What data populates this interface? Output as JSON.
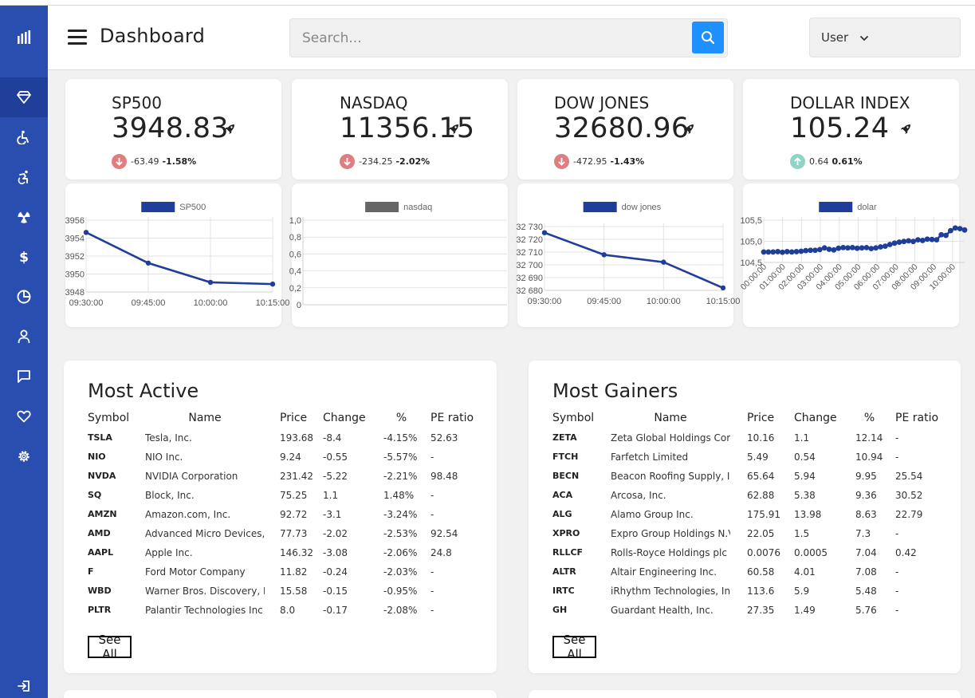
{
  "header": {
    "title": "Dashboard",
    "search_placeholder": "Search...",
    "user_label": "User"
  },
  "sidebar": {
    "items": [
      {
        "icon": "bar-chart-icon"
      },
      {
        "icon": "diamond-icon"
      },
      {
        "icon": "wheelchair-icon"
      },
      {
        "icon": "accessible-running-icon"
      },
      {
        "icon": "radiation-icon"
      },
      {
        "icon": "dollar-icon"
      },
      {
        "icon": "pie-chart-icon"
      },
      {
        "icon": "user-icon"
      },
      {
        "icon": "message-icon"
      },
      {
        "icon": "heart-icon"
      },
      {
        "icon": "gear-icon"
      },
      {
        "icon": "logout-icon"
      }
    ]
  },
  "indices": [
    {
      "name": "SP500",
      "value": "3948.83",
      "change": "-63.49",
      "percent": "-1.58%",
      "direction": "down"
    },
    {
      "name": "NASDAQ",
      "value": "11356.15",
      "change": "-234.25",
      "percent": "-2.02%",
      "direction": "down"
    },
    {
      "name": "DOW JONES",
      "value": "32680.96",
      "change": "-472.95",
      "percent": "-1.43%",
      "direction": "down"
    },
    {
      "name": "DOLLAR INDEX",
      "value": "105.24",
      "change": "0.64",
      "percent": "0.61%",
      "direction": "up"
    }
  ],
  "colors": {
    "sidebar": "#2a4db0",
    "series": "#1f3e99",
    "nasdaq_legend": "#666666",
    "down": "#e07d80",
    "up": "#8fd5c5",
    "search_button": "#1e90ff"
  },
  "chart_data": [
    {
      "type": "line",
      "legend": "SP500",
      "x": [
        "09:30:00",
        "09:45:00",
        "10:00:00",
        "10:15:00"
      ],
      "y": [
        3954.7,
        3951.2,
        3949.0,
        3948.8
      ],
      "yticks": [
        "3956",
        "3954",
        "3952",
        "3950",
        "3948"
      ],
      "ylim": [
        3947.9,
        3956.1
      ],
      "grid": true
    },
    {
      "type": "line",
      "legend": "nasdaq",
      "x": [],
      "y": [],
      "yticks": [
        "1,0",
        "0,8",
        "0,6",
        "0,4",
        "0,2",
        "0"
      ],
      "ylim": [
        0,
        1
      ],
      "grid": true
    },
    {
      "type": "line",
      "legend": "dow jones",
      "x": [
        "09:30:00",
        "09:45:00",
        "10:00:00",
        "10:15:00"
      ],
      "y": [
        32726,
        32708,
        32702,
        32681
      ],
      "yticks": [
        "32 730",
        "32 720",
        "32 710",
        "32 700",
        "32 690",
        "32 680"
      ],
      "ylim": [
        32679,
        32731
      ],
      "grid": true
    },
    {
      "type": "line",
      "legend": "dolar",
      "x": [
        "00:00:00",
        "",
        "",
        "",
        "01:00:00",
        "",
        "",
        "",
        "02:00:00",
        "",
        "",
        "",
        "03:00:00",
        "",
        "",
        "",
        "04:00:00",
        "",
        "",
        "",
        "05:00:00",
        "",
        "",
        "",
        "06:00:00",
        "",
        "",
        "",
        "07:00:00",
        "",
        "",
        "",
        "08:00:00",
        "",
        "",
        "",
        "09:00:00",
        "",
        "",
        "",
        "10:00:00",
        "",
        "",
        ""
      ],
      "xticks": [
        "00:00:00",
        "01:00:00",
        "02:00:00",
        "03:00:00",
        "04:00:00",
        "05:00:00",
        "06:00:00",
        "07:00:00",
        "08:00:00",
        "09:00:00",
        "10:00:00"
      ],
      "y": [
        104.56,
        104.56,
        104.56,
        104.57,
        104.55,
        104.57,
        104.56,
        104.57,
        104.58,
        104.6,
        104.61,
        104.61,
        104.63,
        104.68,
        104.64,
        104.62,
        104.67,
        104.69,
        104.68,
        104.69,
        104.67,
        104.68,
        104.69,
        104.66,
        104.68,
        104.71,
        104.73,
        104.78,
        104.82,
        104.85,
        104.87,
        104.89,
        104.87,
        104.92,
        104.9,
        104.94,
        104.93,
        104.92,
        105.07,
        105.05,
        105.19,
        105.27,
        105.25,
        105.21
      ],
      "yticks": [
        "105,5",
        "105,0",
        "104,5"
      ],
      "ylim": [
        104.25,
        105.5
      ],
      "grid": true
    }
  ],
  "most_active": {
    "title": "Most Active",
    "columns": [
      "Symbol",
      "Name",
      "Price",
      "Change",
      "%",
      "PE ratio"
    ],
    "rows": [
      [
        "TSLA",
        "Tesla, Inc.",
        "193.68",
        "-8.4",
        "-4.15%",
        "52.63"
      ],
      [
        "NIO",
        "NIO Inc.",
        "9.24",
        "-0.55",
        "-5.57%",
        "-"
      ],
      [
        "NVDA",
        "NVIDIA Corporation",
        "231.42",
        "-5.22",
        "-2.21%",
        "98.48"
      ],
      [
        "SQ",
        "Block, Inc.",
        "75.25",
        "1.1",
        "1.48%",
        "-"
      ],
      [
        "AMZN",
        "Amazon.com, Inc.",
        "92.72",
        "-3.1",
        "-3.24%",
        "-"
      ],
      [
        "AMD",
        "Advanced Micro Devices,",
        "77.73",
        "-2.02",
        "-2.53%",
        "92.54"
      ],
      [
        "AAPL",
        "Apple Inc.",
        "146.32",
        "-3.08",
        "-2.06%",
        "24.8"
      ],
      [
        "F",
        "Ford Motor Company",
        "11.82",
        "-0.24",
        "-2.03%",
        "-"
      ],
      [
        "WBD",
        "Warner Bros. Discovery, Ir",
        "15.58",
        "-0.15",
        "-0.95%",
        "-"
      ],
      [
        "PLTR",
        "Palantir Technologies Inc",
        "8.0",
        "-0.17",
        "-2.08%",
        "-"
      ]
    ],
    "see_all": "See All"
  },
  "most_gainers": {
    "title": "Most Gainers",
    "columns": [
      "Symbol",
      "Name",
      "Price",
      "Change",
      "%",
      "PE ratio"
    ],
    "rows": [
      [
        "ZETA",
        "Zeta Global Holdings Cor",
        "10.16",
        "1.1",
        "12.14",
        "-"
      ],
      [
        "FTCH",
        "Farfetch Limited",
        "5.49",
        "0.54",
        "10.94",
        "-"
      ],
      [
        "BECN",
        "Beacon Roofing Supply, Ir",
        "65.64",
        "5.94",
        "9.95",
        "25.54"
      ],
      [
        "ACA",
        "Arcosa, Inc.",
        "62.88",
        "5.38",
        "9.36",
        "30.52"
      ],
      [
        "ALG",
        "Alamo Group Inc.",
        "175.91",
        "13.98",
        "8.63",
        "22.79"
      ],
      [
        "XPRO",
        "Expro Group Holdings N.V",
        "22.05",
        "1.5",
        "7.3",
        "-"
      ],
      [
        "RLLCF",
        "Rolls-Royce Holdings plc",
        "0.0076",
        "0.0005",
        "7.04",
        "0.42"
      ],
      [
        "ALTR",
        "Altair Engineering Inc.",
        "60.58",
        "4.01",
        "7.08",
        "-"
      ],
      [
        "IRTC",
        "iRhythm Technologies, Inc",
        "113.6",
        "5.9",
        "5.48",
        "-"
      ],
      [
        "GH",
        "Guardant Health, Inc.",
        "27.35",
        "1.49",
        "5.76",
        "-"
      ]
    ],
    "see_all": "See All"
  }
}
